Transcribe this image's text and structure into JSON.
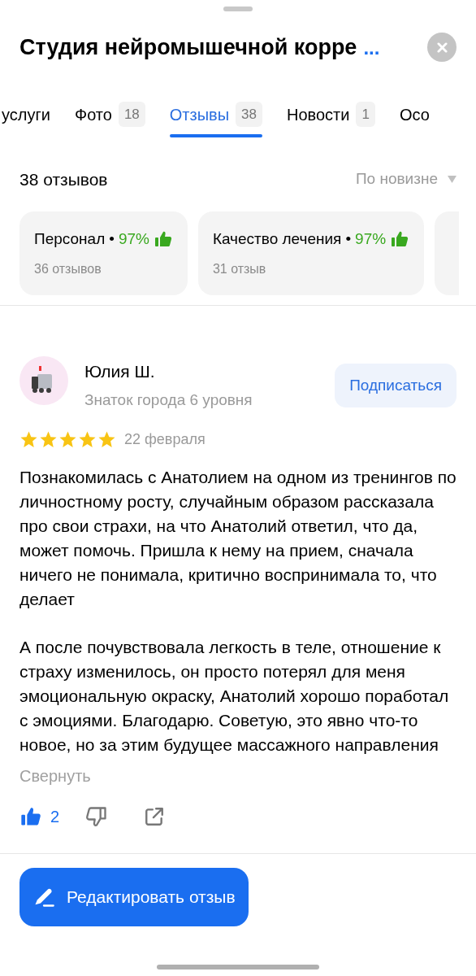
{
  "header": {
    "title": "Студия нейромышечной корре",
    "more": "..."
  },
  "tabs": [
    {
      "label": "услуги",
      "selected": false
    },
    {
      "label": "Фото",
      "count": "18",
      "selected": false
    },
    {
      "label": "Отзывы",
      "count": "38",
      "selected": true
    },
    {
      "label": "Новости",
      "count": "1",
      "selected": false
    },
    {
      "label": "Осо",
      "selected": false
    }
  ],
  "reviews_summary": {
    "title": "38 отзывов",
    "sort": "По новизне"
  },
  "aspects": [
    {
      "name": "Персонал",
      "separator": "•",
      "percent": "97%",
      "count": "36 отзывов"
    },
    {
      "name": "Качество лечения",
      "separator": "•",
      "percent": "97%",
      "count": "31 отзыв"
    }
  ],
  "review": {
    "author": "Юлия Ш.",
    "level": "Знаток города 6 уровня",
    "subscribe": "Подписаться",
    "stars": 5,
    "date": "22 февраля",
    "paragraphs": [
      "Познакомилась с Анатолием на одном из тренингов по личностному росту, случайным образом рассказала про свои страхи, на что Анатолий ответил, что да, может помочь. Пришла к нему на прием, сначала ничего не понимала, критично воспринимала то, что делает",
      "А после почувствовала легкость в теле, отношение к страху изменилось, он просто потерял для меня эмоциональную окраску, Анатолий хорошо поработал с эмоциями. Благодарю. Советую, это явно что-то новое, но за этим будущее массажного направления"
    ],
    "collapse": "Свернуть",
    "likes": "2",
    "liked": true
  },
  "edit_button": "Редактировать отзыв"
}
